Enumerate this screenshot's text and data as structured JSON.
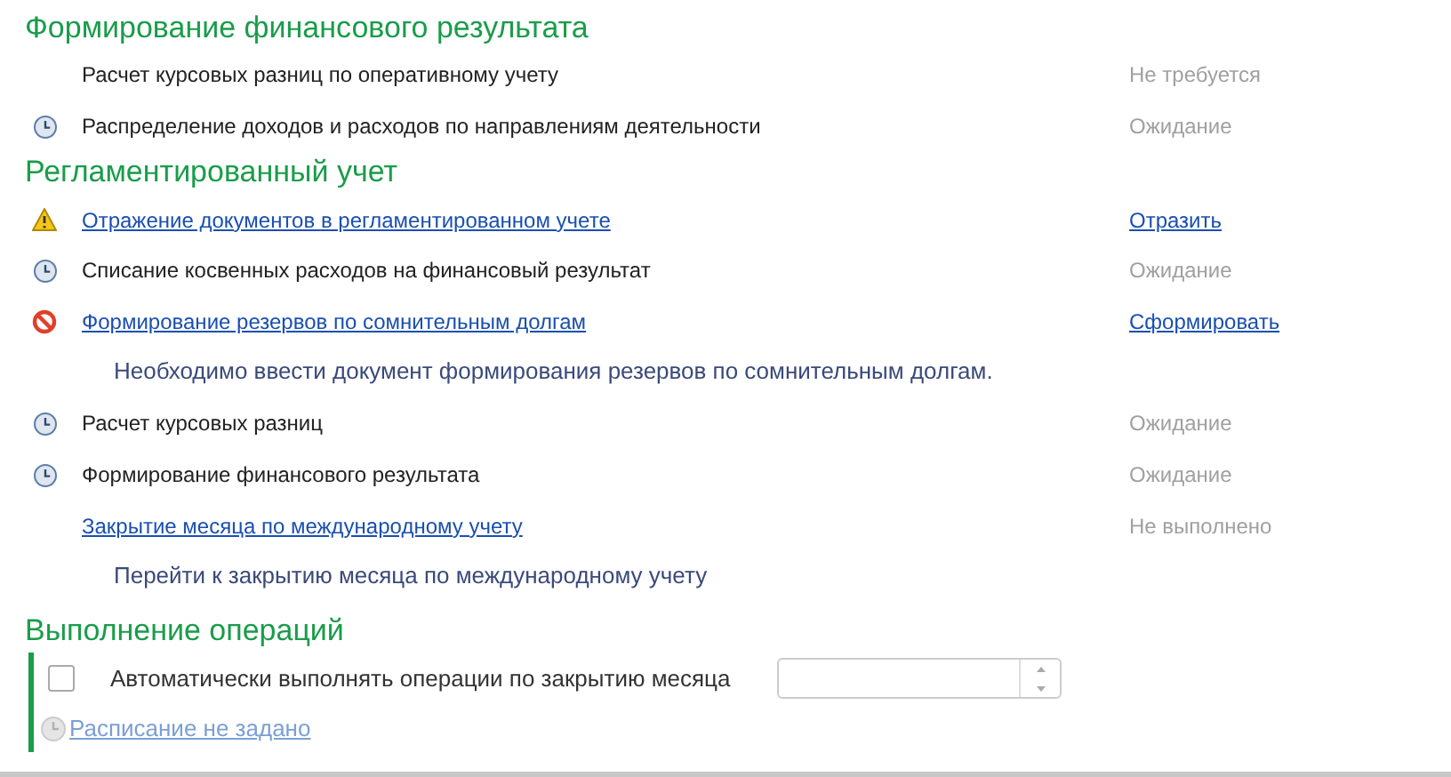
{
  "sections": [
    {
      "title": "Формирование финансового результата",
      "items": [
        {
          "kind": "plain",
          "title": "Расчет курсовых разниц по оперативному учету",
          "is_link": false,
          "status": {
            "kind": "text",
            "text": "Не требуется"
          }
        },
        {
          "kind": "pending",
          "title": "Распределение доходов и расходов по направлениям деятельности",
          "is_link": false,
          "status": {
            "kind": "text",
            "text": "Ожидание"
          }
        }
      ]
    },
    {
      "title": "Регламентированный учет",
      "items": [
        {
          "kind": "warning",
          "title": "Отражение документов в регламентированном учете",
          "is_link": true,
          "status": {
            "kind": "link",
            "text": "Отразить"
          }
        },
        {
          "kind": "pending",
          "title": "Списание косвенных расходов на финансовый результат",
          "is_link": false,
          "status": {
            "kind": "text",
            "text": "Ожидание"
          }
        },
        {
          "kind": "error",
          "title": "Формирование резервов по сомнительным долгам",
          "is_link": true,
          "status": {
            "kind": "link",
            "text": "Сформировать"
          }
        },
        {
          "kind": "note",
          "text": "Необходимо ввести документ формирования резервов по сомнительным долгам."
        },
        {
          "kind": "pending",
          "title": "Расчет курсовых разниц",
          "is_link": false,
          "status": {
            "kind": "text",
            "text": "Ожидание"
          }
        },
        {
          "kind": "pending",
          "title": "Формирование финансового результата",
          "is_link": false,
          "status": {
            "kind": "text",
            "text": "Ожидание"
          }
        },
        {
          "kind": "plain",
          "title": "Закрытие месяца по международному учету",
          "is_link": true,
          "status": {
            "kind": "text",
            "text": "Не выполнено"
          }
        },
        {
          "kind": "note",
          "text": "Перейти к закрытию месяца по международному учету"
        }
      ]
    }
  ],
  "operations": {
    "title": "Выполнение операций",
    "auto": {
      "label": "Автоматически выполнять операции по закрытию месяца",
      "checked": false
    },
    "schedule": {
      "text": "Расписание не задано",
      "disabled": true
    }
  }
}
